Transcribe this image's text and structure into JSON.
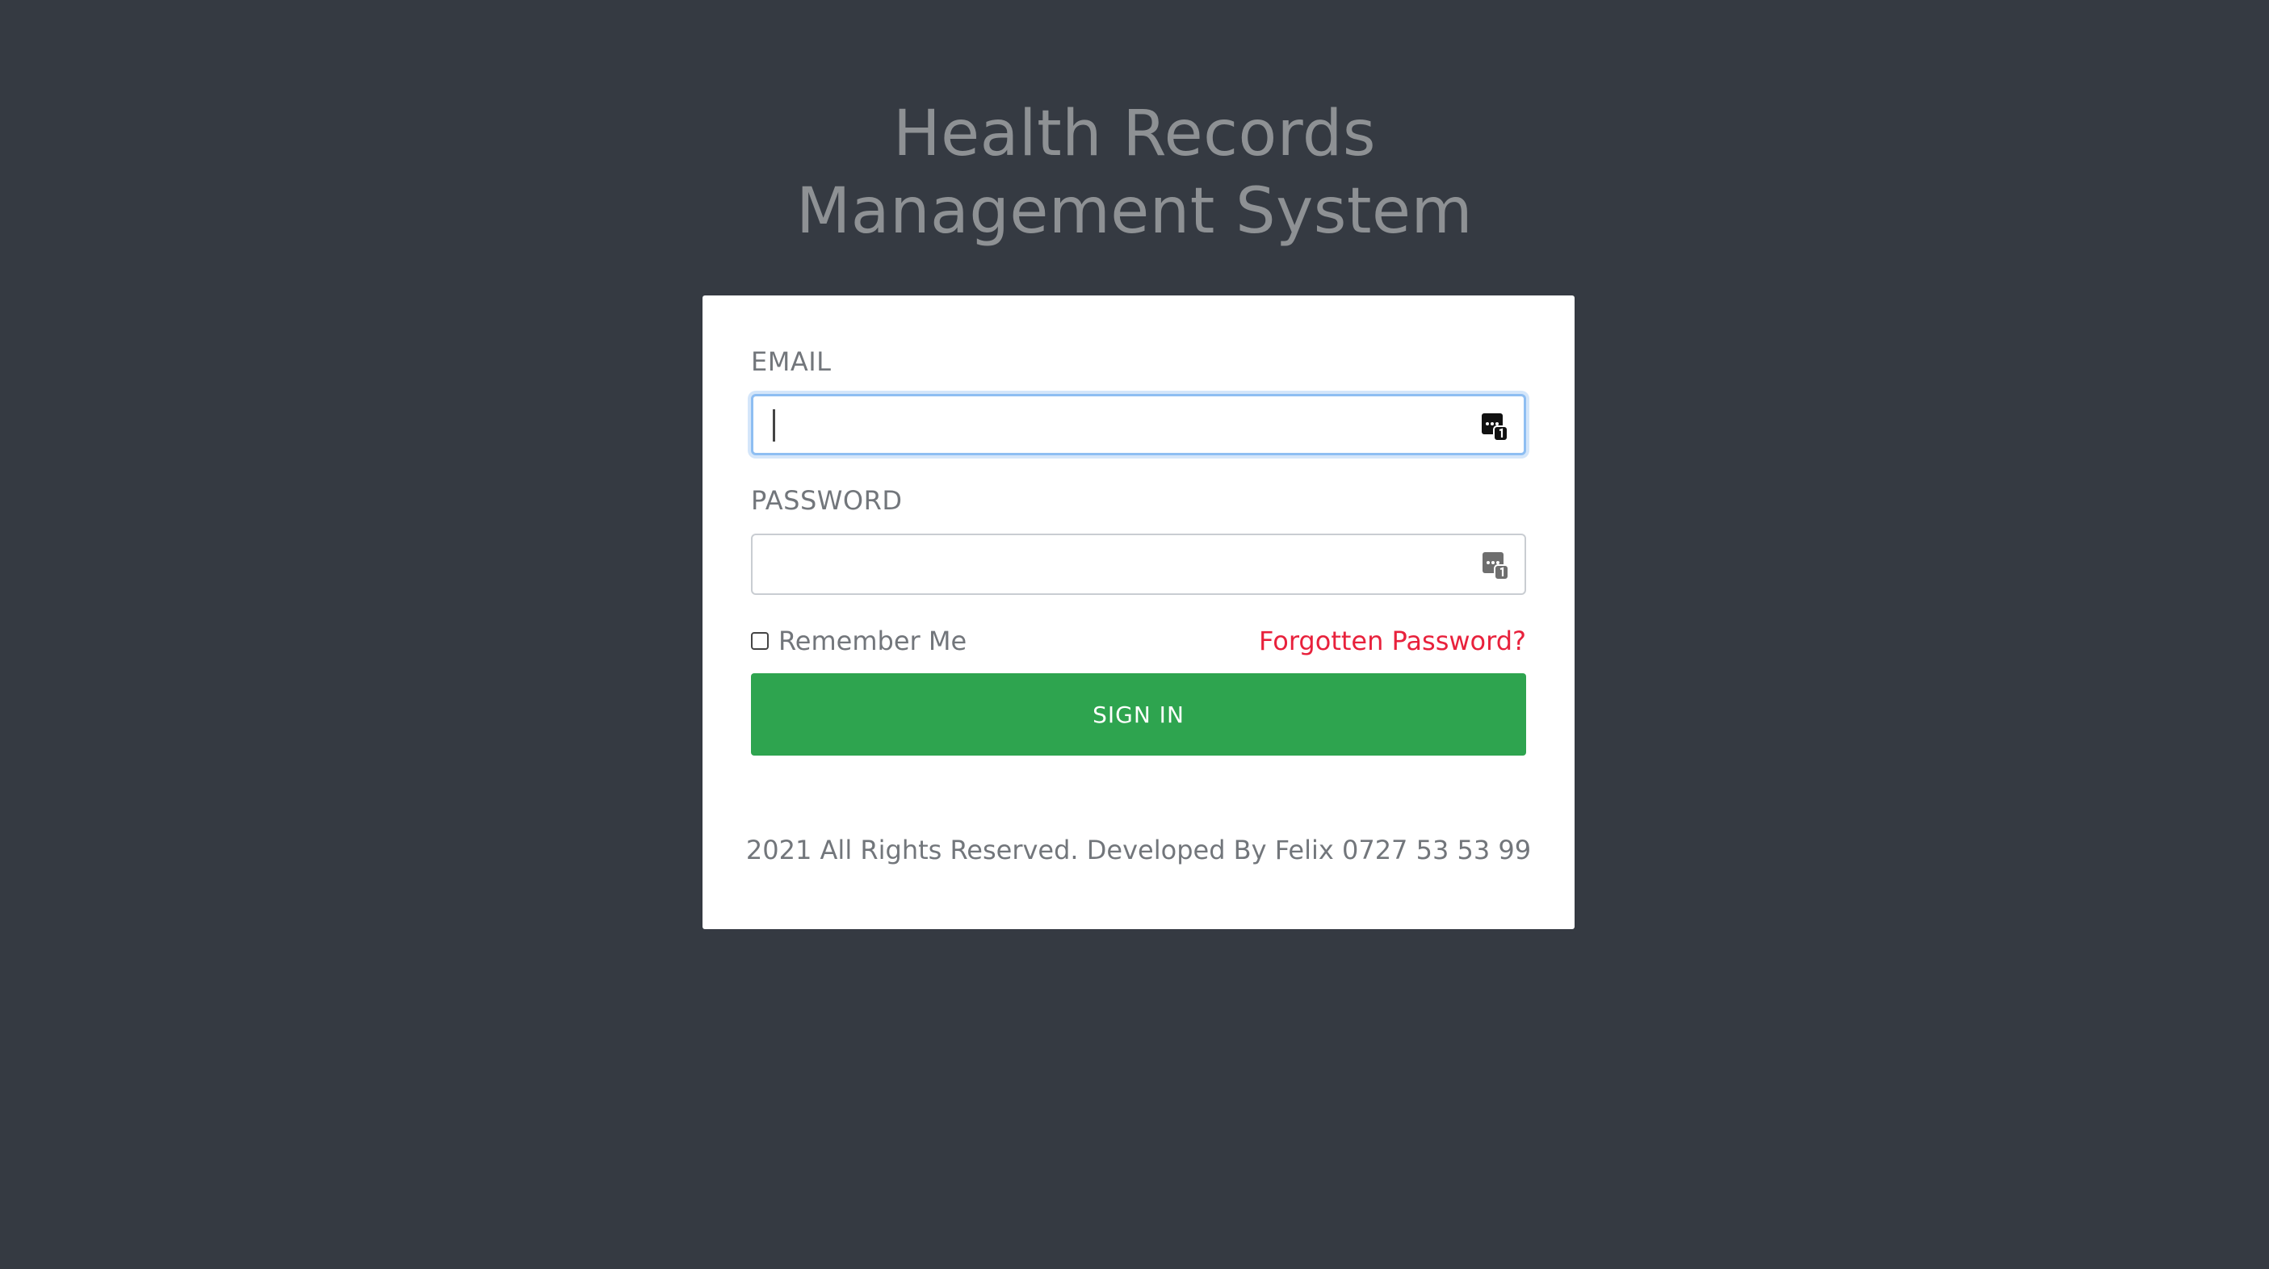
{
  "header": {
    "title_line1": "Health Records",
    "title_line2": "Management System"
  },
  "form": {
    "email_label": "EMAIL",
    "email_value": "",
    "password_label": "PASSWORD",
    "password_value": "",
    "remember_label": "Remember Me",
    "remember_checked": false,
    "forgot_link": "Forgotten Password?",
    "signin_label": "SIGN IN"
  },
  "footer": {
    "text": "2021 All Rights Reserved. Developed By Felix 0727 53 53 99"
  },
  "icons": {
    "field_icon": "password-manager-icon"
  },
  "colors": {
    "background": "#353a42",
    "accent_green": "#2ea44f",
    "link_red": "#e8213c",
    "focus_blue": "#8ebef2"
  }
}
